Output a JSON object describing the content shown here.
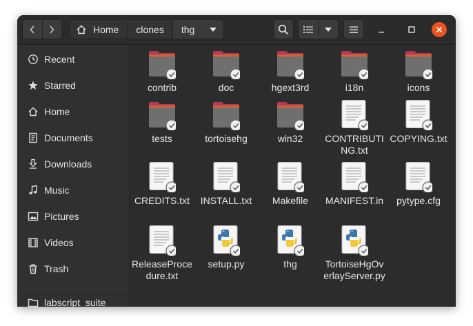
{
  "header": {
    "path": [
      "Home",
      "clones",
      "thg"
    ]
  },
  "sidebar": {
    "items": [
      {
        "icon": "clock-icon",
        "label": "Recent"
      },
      {
        "icon": "star-icon",
        "label": "Starred"
      },
      {
        "icon": "home-icon",
        "label": "Home"
      },
      {
        "icon": "document-icon",
        "label": "Documents"
      },
      {
        "icon": "download-icon",
        "label": "Downloads"
      },
      {
        "icon": "music-icon",
        "label": "Music"
      },
      {
        "icon": "picture-icon",
        "label": "Pictures"
      },
      {
        "icon": "video-icon",
        "label": "Videos"
      },
      {
        "icon": "trash-icon",
        "label": "Trash"
      }
    ],
    "bookmarks": [
      {
        "icon": "folder-icon",
        "label": "labscript_suite"
      }
    ]
  },
  "files": [
    {
      "name": "contrib",
      "type": "folder"
    },
    {
      "name": "doc",
      "type": "folder"
    },
    {
      "name": "hgext3rd",
      "type": "folder"
    },
    {
      "name": "i18n",
      "type": "folder"
    },
    {
      "name": "icons",
      "type": "folder"
    },
    {
      "name": "tests",
      "type": "folder"
    },
    {
      "name": "tortoisehg",
      "type": "folder"
    },
    {
      "name": "win32",
      "type": "folder"
    },
    {
      "name": "CONTRIBUTING.txt",
      "type": "text"
    },
    {
      "name": "COPYING.txt",
      "type": "text"
    },
    {
      "name": "CREDITS.txt",
      "type": "text"
    },
    {
      "name": "INSTALL.txt",
      "type": "text"
    },
    {
      "name": "Makefile",
      "type": "text"
    },
    {
      "name": "MANIFEST.in",
      "type": "text"
    },
    {
      "name": "pytype.cfg",
      "type": "text"
    },
    {
      "name": "ReleaseProcedure.txt",
      "type": "text"
    },
    {
      "name": "setup.py",
      "type": "python"
    },
    {
      "name": "thg",
      "type": "python"
    },
    {
      "name": "TortoiseHgOverlayServer.py",
      "type": "python"
    }
  ],
  "colors": {
    "folder_tab": "#b03a59",
    "folder_body": "#6f6f6f",
    "close_button": "#e95420"
  }
}
